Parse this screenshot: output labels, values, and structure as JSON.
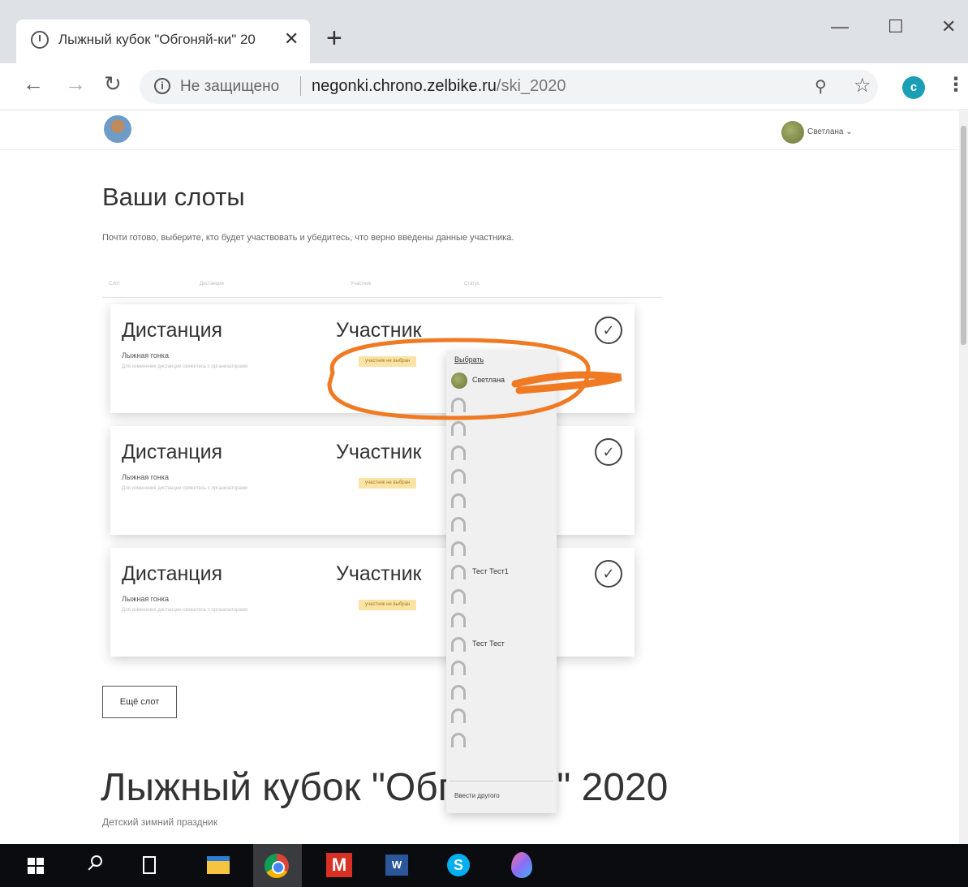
{
  "browser": {
    "tab_title": "Лыжный кубок \"Обгоняй-ки\" 20",
    "address": {
      "security_label": "Не защищено",
      "host": "negonki.chrono.zelbike.ru",
      "path": "/ski_2020"
    },
    "profile_letter": "c"
  },
  "header": {
    "user_name": "Светлана ⌄"
  },
  "slots_section": {
    "title": "Ваши слоты",
    "subtitle": "Почти готово, выберите, кто будет участвовать и убедитесь, что верно введены данные участника.",
    "column_headers": [
      "Слот",
      "Дистанция",
      "Участник",
      "Статус"
    ],
    "slots": [
      {
        "distance_label": "Дистанция",
        "race_name": "Лыжная гонка",
        "note": "Для изменения дистанции свяжитесь с организаторами",
        "participant_label": "Участник",
        "badge": "участник не выбран"
      },
      {
        "distance_label": "Дистанция",
        "race_name": "Лыжная гонка",
        "note": "Для изменения дистанции свяжитесь с организаторами",
        "participant_label": "Участник",
        "badge": "участник не выбран"
      },
      {
        "distance_label": "Дистанция",
        "race_name": "Лыжная гонка",
        "note": "Для изменения дистанции свяжитесь с организаторами",
        "participant_label": "Участник",
        "badge": "участник не выбран"
      }
    ],
    "more_slot_button": "Ещё слот"
  },
  "participant_dropdown": {
    "choose_label": "Выбрать",
    "items": [
      {
        "name": "Светлана",
        "avatar": true
      },
      {
        "name": "",
        "avatar": false
      },
      {
        "name": "",
        "avatar": false
      },
      {
        "name": "",
        "avatar": false
      },
      {
        "name": "",
        "avatar": false
      },
      {
        "name": "",
        "avatar": false
      },
      {
        "name": "",
        "avatar": false
      },
      {
        "name": "",
        "avatar": false
      },
      {
        "name": "Тест Тест1",
        "avatar": false
      },
      {
        "name": "",
        "avatar": false
      },
      {
        "name": "",
        "avatar": false
      },
      {
        "name": "Тест Тест",
        "avatar": false
      },
      {
        "name": "",
        "avatar": false
      },
      {
        "name": "",
        "avatar": false
      },
      {
        "name": "",
        "avatar": false
      },
      {
        "name": "",
        "avatar": false
      }
    ],
    "enter_other": "Ввести другого"
  },
  "event": {
    "title": "Лыжный кубок \"Обгс",
    "title_tail": "\" 2020",
    "subtitle": "Детский зимний праздник"
  },
  "colors": {
    "annotation": "#f07a24",
    "badge_bg": "#fbe3a6",
    "taskbar": "#0b0c10",
    "profile": "#1a9fb5"
  },
  "taskbar_icons": [
    "windows-start",
    "search",
    "task-view",
    "file-explorer",
    "chrome",
    "gmail",
    "word",
    "skype",
    "paint-3d"
  ]
}
